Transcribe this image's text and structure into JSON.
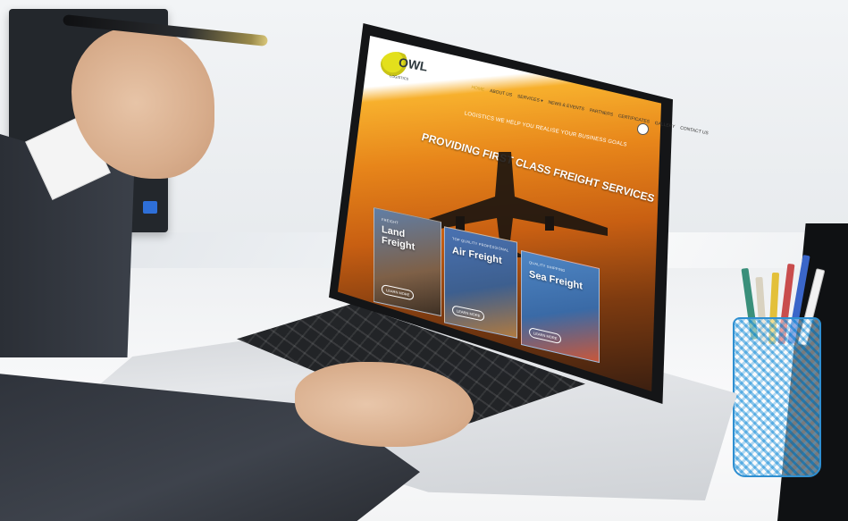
{
  "scene": {
    "description_icons": [
      "laptop-icon",
      "pen-icon",
      "pencil-cup-icon"
    ]
  },
  "website": {
    "logo_text": "OWL",
    "logo_subtext": "LOGISTICS",
    "nav": [
      "HOME",
      "ABOUT US",
      "SERVICES ▾",
      "NEWS & EVENTS",
      "PARTNERS",
      "CERTIFICATES",
      "GALLERY",
      "CONTACT US"
    ],
    "hero_tagline": "LOGISTICS WE HELP YOU REALISE YOUR BUSINESS GOALS",
    "hero_title": "PROVIDING FIRST CLASS FREIGHT SERVICES",
    "cards": [
      {
        "subtitle": "FREIGHT",
        "title": "Land Freight",
        "button": "LEARN MORE"
      },
      {
        "subtitle": "TOP QUALITY PROFESSIONAL",
        "title": "Air Freight",
        "button": "LEARN MORE"
      },
      {
        "subtitle": "QUALITY SHIPPING",
        "title": "Sea Freight",
        "button": "LEARN MORE"
      }
    ]
  },
  "colors": {
    "logo_yellow": "#e3e01c",
    "hero_orange": "#e7851a",
    "nav_active": "#d3a21b",
    "cup_blue": "#2f8fd1"
  }
}
